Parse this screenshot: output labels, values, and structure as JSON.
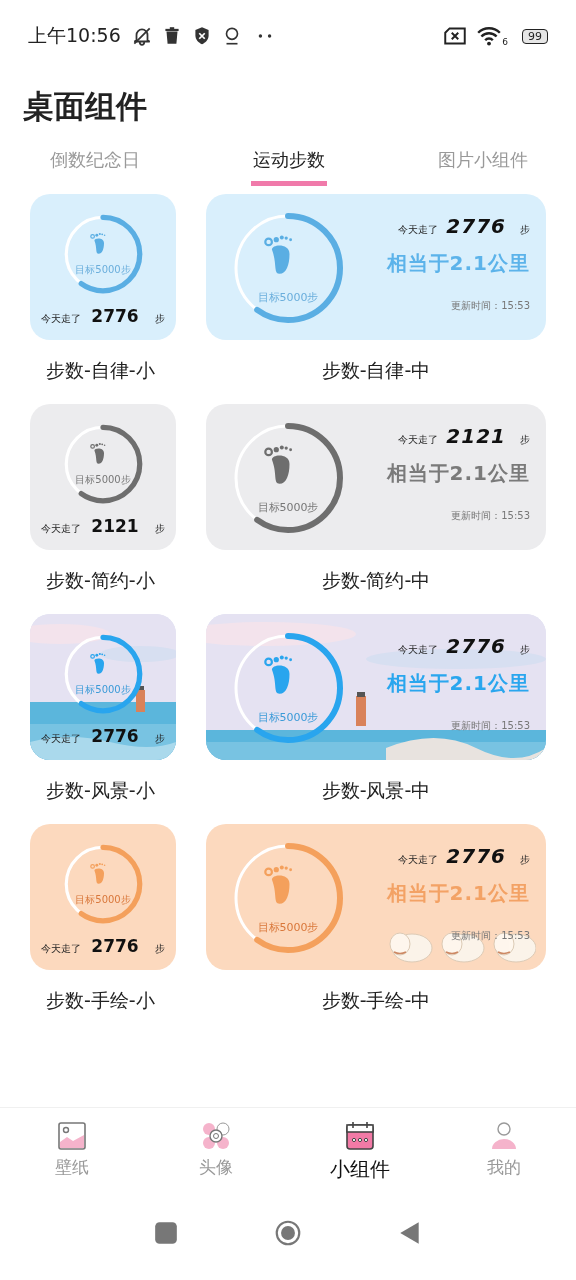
{
  "status_bar": {
    "time": "上午10:56",
    "battery": "99",
    "wifi_badge": "6"
  },
  "title": "桌面组件",
  "tabs": [
    {
      "label": "倒数纪念日",
      "selected": false
    },
    {
      "label": "运动步数",
      "selected": true
    },
    {
      "label": "图片小组件",
      "selected": false
    }
  ],
  "widget_rows": [
    {
      "kind": "self",
      "small": {
        "goal": "目标5000步",
        "level": 0.6,
        "walked": "今天走了",
        "steps": "2776",
        "unit": "步",
        "caption": "步数-自律-小"
      },
      "medium": {
        "goal": "目标5000步",
        "level": 0.6,
        "walked": "今天走了",
        "steps": "2776",
        "unit": "步",
        "distance": "相当于2.1公里",
        "updated": "更新时间：15:53",
        "caption": "步数-自律-中"
      }
    },
    {
      "kind": "simple",
      "small": {
        "goal": "目标5000步",
        "level": 0.6,
        "walked": "今天走了",
        "steps": "2121",
        "unit": "步",
        "caption": "步数-简约-小"
      },
      "medium": {
        "goal": "目标5000步",
        "level": 0.6,
        "walked": "今天走了",
        "steps": "2121",
        "unit": "步",
        "distance": "相当于2.1公里",
        "updated": "更新时间：15:53",
        "caption": "步数-简约-中"
      }
    },
    {
      "kind": "scenery",
      "small": {
        "goal": "目标5000步",
        "level": 0.6,
        "walked": "今天走了",
        "steps": "2776",
        "unit": "步",
        "caption": "步数-风景-小"
      },
      "medium": {
        "goal": "目标5000步",
        "level": 0.6,
        "walked": "今天走了",
        "steps": "2776",
        "unit": "步",
        "distance": "相当于2.1公里",
        "updated": "更新时间：15:53",
        "caption": "步数-风景-中"
      }
    },
    {
      "kind": "drawn",
      "small": {
        "goal": "目标5000步",
        "level": 0.6,
        "walked": "今天走了",
        "steps": "2776",
        "unit": "步",
        "caption": "步数-手绘-小"
      },
      "medium": {
        "goal": "目标5000步",
        "level": 0.6,
        "walked": "今天走了",
        "steps": "2776",
        "unit": "步",
        "distance": "相当于2.1公里",
        "updated": "更新时间：15:53",
        "caption": "步数-手绘-中"
      }
    }
  ],
  "bottom_nav": [
    {
      "label": "壁纸",
      "selected": false,
      "kind": "wallpaper"
    },
    {
      "label": "头像",
      "selected": false,
      "kind": "avatar"
    },
    {
      "label": "小组件",
      "selected": true,
      "kind": "widget"
    },
    {
      "label": "我的",
      "selected": false,
      "kind": "profile"
    }
  ]
}
